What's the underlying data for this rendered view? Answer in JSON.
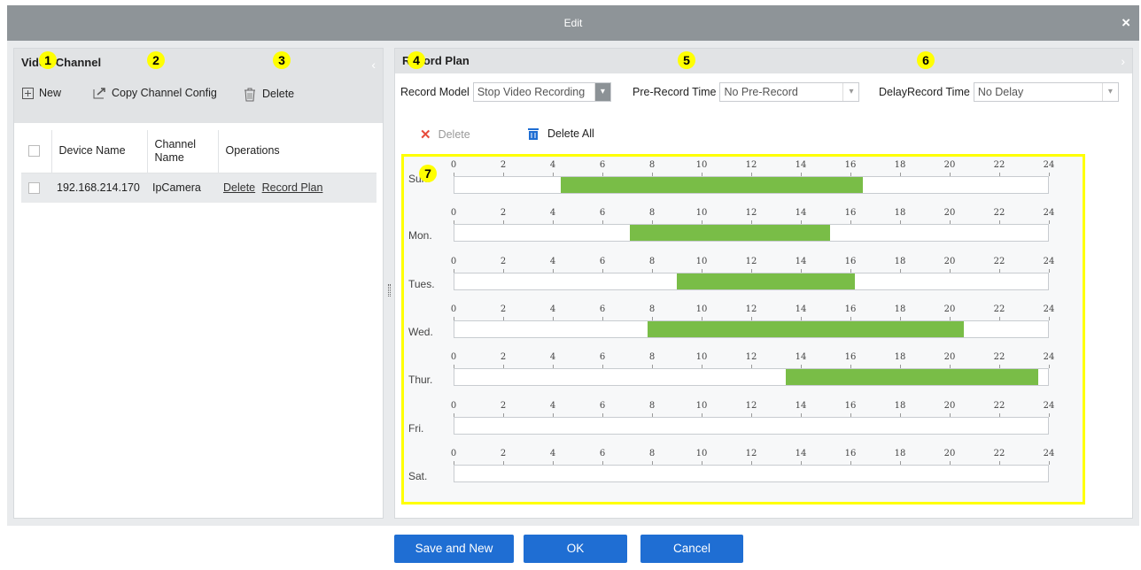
{
  "dialog": {
    "title": "Edit",
    "close_glyph": "×"
  },
  "left_panel": {
    "title": "Video Channel",
    "toolbar": {
      "new": "New",
      "copy": "Copy Channel Config",
      "delete": "Delete"
    },
    "columns": [
      "Device Name",
      "Channel Name",
      "Operations"
    ],
    "rows": [
      {
        "device": "192.168.214.170",
        "channel": "IpCamera",
        "op_delete": "Delete",
        "op_plan": "Record Plan"
      }
    ]
  },
  "right_panel": {
    "title": "Record Plan",
    "record_model": {
      "label": "Record Model",
      "value": "Stop Video Recording"
    },
    "pre_record": {
      "label": "Pre-Record Time",
      "value": "No Pre-Record"
    },
    "delay_record": {
      "label": "DelayRecord Time",
      "value": "No Delay"
    },
    "actions": {
      "delete": "Delete",
      "delete_all": "Delete All"
    },
    "ticks": [
      "0",
      "2",
      "4",
      "6",
      "8",
      "10",
      "12",
      "14",
      "16",
      "18",
      "20",
      "22",
      "24"
    ],
    "days": [
      {
        "label": "Sun.",
        "start": 4.3,
        "end": 16.5
      },
      {
        "label": "Mon.",
        "start": 7.1,
        "end": 15.2
      },
      {
        "label": "Tues.",
        "start": 9.0,
        "end": 16.2
      },
      {
        "label": "Wed.",
        "start": 7.8,
        "end": 20.6
      },
      {
        "label": "Thur.",
        "start": 13.4,
        "end": 23.6
      },
      {
        "label": "Fri.",
        "start": null,
        "end": null
      },
      {
        "label": "Sat.",
        "start": null,
        "end": null
      }
    ]
  },
  "annotations": [
    "1",
    "2",
    "3",
    "4",
    "5",
    "6",
    "7"
  ],
  "footer": {
    "save_new": "Save and New",
    "ok": "OK",
    "cancel": "Cancel"
  },
  "colors": {
    "fill": "#79bd47",
    "button": "#1f6ed3",
    "highlight": "#ffff00",
    "titlebar": "#8e9498"
  }
}
